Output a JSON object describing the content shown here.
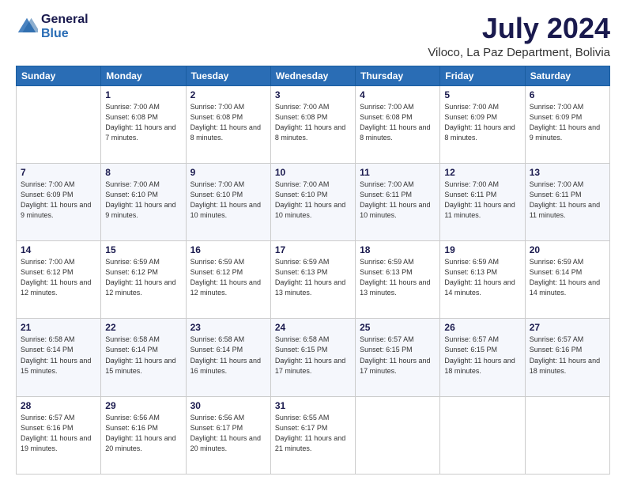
{
  "header": {
    "logo": {
      "general": "General",
      "blue": "Blue"
    },
    "title": "July 2024",
    "subtitle": "Viloco, La Paz Department, Bolivia"
  },
  "days_of_week": [
    "Sunday",
    "Monday",
    "Tuesday",
    "Wednesday",
    "Thursday",
    "Friday",
    "Saturday"
  ],
  "weeks": [
    [
      {
        "day": "",
        "sunrise": "",
        "sunset": "",
        "daylight": ""
      },
      {
        "day": "1",
        "sunrise": "Sunrise: 7:00 AM",
        "sunset": "Sunset: 6:08 PM",
        "daylight": "Daylight: 11 hours and 7 minutes."
      },
      {
        "day": "2",
        "sunrise": "Sunrise: 7:00 AM",
        "sunset": "Sunset: 6:08 PM",
        "daylight": "Daylight: 11 hours and 8 minutes."
      },
      {
        "day": "3",
        "sunrise": "Sunrise: 7:00 AM",
        "sunset": "Sunset: 6:08 PM",
        "daylight": "Daylight: 11 hours and 8 minutes."
      },
      {
        "day": "4",
        "sunrise": "Sunrise: 7:00 AM",
        "sunset": "Sunset: 6:08 PM",
        "daylight": "Daylight: 11 hours and 8 minutes."
      },
      {
        "day": "5",
        "sunrise": "Sunrise: 7:00 AM",
        "sunset": "Sunset: 6:09 PM",
        "daylight": "Daylight: 11 hours and 8 minutes."
      },
      {
        "day": "6",
        "sunrise": "Sunrise: 7:00 AM",
        "sunset": "Sunset: 6:09 PM",
        "daylight": "Daylight: 11 hours and 9 minutes."
      }
    ],
    [
      {
        "day": "7",
        "sunrise": "Sunrise: 7:00 AM",
        "sunset": "Sunset: 6:09 PM",
        "daylight": "Daylight: 11 hours and 9 minutes."
      },
      {
        "day": "8",
        "sunrise": "Sunrise: 7:00 AM",
        "sunset": "Sunset: 6:10 PM",
        "daylight": "Daylight: 11 hours and 9 minutes."
      },
      {
        "day": "9",
        "sunrise": "Sunrise: 7:00 AM",
        "sunset": "Sunset: 6:10 PM",
        "daylight": "Daylight: 11 hours and 10 minutes."
      },
      {
        "day": "10",
        "sunrise": "Sunrise: 7:00 AM",
        "sunset": "Sunset: 6:10 PM",
        "daylight": "Daylight: 11 hours and 10 minutes."
      },
      {
        "day": "11",
        "sunrise": "Sunrise: 7:00 AM",
        "sunset": "Sunset: 6:11 PM",
        "daylight": "Daylight: 11 hours and 10 minutes."
      },
      {
        "day": "12",
        "sunrise": "Sunrise: 7:00 AM",
        "sunset": "Sunset: 6:11 PM",
        "daylight": "Daylight: 11 hours and 11 minutes."
      },
      {
        "day": "13",
        "sunrise": "Sunrise: 7:00 AM",
        "sunset": "Sunset: 6:11 PM",
        "daylight": "Daylight: 11 hours and 11 minutes."
      }
    ],
    [
      {
        "day": "14",
        "sunrise": "Sunrise: 7:00 AM",
        "sunset": "Sunset: 6:12 PM",
        "daylight": "Daylight: 11 hours and 12 minutes."
      },
      {
        "day": "15",
        "sunrise": "Sunrise: 6:59 AM",
        "sunset": "Sunset: 6:12 PM",
        "daylight": "Daylight: 11 hours and 12 minutes."
      },
      {
        "day": "16",
        "sunrise": "Sunrise: 6:59 AM",
        "sunset": "Sunset: 6:12 PM",
        "daylight": "Daylight: 11 hours and 12 minutes."
      },
      {
        "day": "17",
        "sunrise": "Sunrise: 6:59 AM",
        "sunset": "Sunset: 6:13 PM",
        "daylight": "Daylight: 11 hours and 13 minutes."
      },
      {
        "day": "18",
        "sunrise": "Sunrise: 6:59 AM",
        "sunset": "Sunset: 6:13 PM",
        "daylight": "Daylight: 11 hours and 13 minutes."
      },
      {
        "day": "19",
        "sunrise": "Sunrise: 6:59 AM",
        "sunset": "Sunset: 6:13 PM",
        "daylight": "Daylight: 11 hours and 14 minutes."
      },
      {
        "day": "20",
        "sunrise": "Sunrise: 6:59 AM",
        "sunset": "Sunset: 6:14 PM",
        "daylight": "Daylight: 11 hours and 14 minutes."
      }
    ],
    [
      {
        "day": "21",
        "sunrise": "Sunrise: 6:58 AM",
        "sunset": "Sunset: 6:14 PM",
        "daylight": "Daylight: 11 hours and 15 minutes."
      },
      {
        "day": "22",
        "sunrise": "Sunrise: 6:58 AM",
        "sunset": "Sunset: 6:14 PM",
        "daylight": "Daylight: 11 hours and 15 minutes."
      },
      {
        "day": "23",
        "sunrise": "Sunrise: 6:58 AM",
        "sunset": "Sunset: 6:14 PM",
        "daylight": "Daylight: 11 hours and 16 minutes."
      },
      {
        "day": "24",
        "sunrise": "Sunrise: 6:58 AM",
        "sunset": "Sunset: 6:15 PM",
        "daylight": "Daylight: 11 hours and 17 minutes."
      },
      {
        "day": "25",
        "sunrise": "Sunrise: 6:57 AM",
        "sunset": "Sunset: 6:15 PM",
        "daylight": "Daylight: 11 hours and 17 minutes."
      },
      {
        "day": "26",
        "sunrise": "Sunrise: 6:57 AM",
        "sunset": "Sunset: 6:15 PM",
        "daylight": "Daylight: 11 hours and 18 minutes."
      },
      {
        "day": "27",
        "sunrise": "Sunrise: 6:57 AM",
        "sunset": "Sunset: 6:16 PM",
        "daylight": "Daylight: 11 hours and 18 minutes."
      }
    ],
    [
      {
        "day": "28",
        "sunrise": "Sunrise: 6:57 AM",
        "sunset": "Sunset: 6:16 PM",
        "daylight": "Daylight: 11 hours and 19 minutes."
      },
      {
        "day": "29",
        "sunrise": "Sunrise: 6:56 AM",
        "sunset": "Sunset: 6:16 PM",
        "daylight": "Daylight: 11 hours and 20 minutes."
      },
      {
        "day": "30",
        "sunrise": "Sunrise: 6:56 AM",
        "sunset": "Sunset: 6:17 PM",
        "daylight": "Daylight: 11 hours and 20 minutes."
      },
      {
        "day": "31",
        "sunrise": "Sunrise: 6:55 AM",
        "sunset": "Sunset: 6:17 PM",
        "daylight": "Daylight: 11 hours and 21 minutes."
      },
      {
        "day": "",
        "sunrise": "",
        "sunset": "",
        "daylight": ""
      },
      {
        "day": "",
        "sunrise": "",
        "sunset": "",
        "daylight": ""
      },
      {
        "day": "",
        "sunrise": "",
        "sunset": "",
        "daylight": ""
      }
    ]
  ]
}
